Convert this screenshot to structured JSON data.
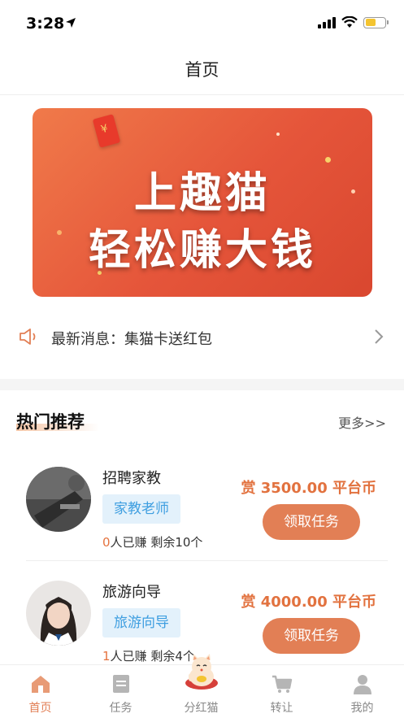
{
  "status_bar": {
    "time": "3:28"
  },
  "nav": {
    "title": "首页"
  },
  "banner": {
    "line1": "上趣猫",
    "line2": "轻松赚大钱"
  },
  "notice": {
    "text": "最新消息：集猫卡送红包"
  },
  "hot": {
    "title": "热门推荐",
    "more": "更多>>",
    "tasks": [
      {
        "title": "招聘家教",
        "tag": "家教老师",
        "earned_count": "0",
        "earned_suffix": "人已赚",
        "remaining": "剩余10个",
        "reward": "赏 3500.00 平台币",
        "button": "领取任务"
      },
      {
        "title": "旅游向导",
        "tag": "旅游向导",
        "earned_count": "1",
        "earned_suffix": "人已赚",
        "remaining": "剩余4个",
        "reward": "赏 4000.00 平台币",
        "button": "领取任务"
      }
    ]
  },
  "tabbar": {
    "items": [
      {
        "label": "首页",
        "icon": "home-icon",
        "active": true
      },
      {
        "label": "任务",
        "icon": "task-icon",
        "active": false
      },
      {
        "label": "分红猫",
        "icon": "lucky-cat-icon",
        "active": false
      },
      {
        "label": "转让",
        "icon": "cart-icon",
        "active": false
      },
      {
        "label": "我的",
        "icon": "profile-icon",
        "active": false
      }
    ]
  },
  "colors": {
    "accent": "#e27f55",
    "reward": "#e2723f",
    "tag_bg": "#e3f1fb",
    "tag_text": "#3e9ee0",
    "banner": "#e5553a"
  }
}
